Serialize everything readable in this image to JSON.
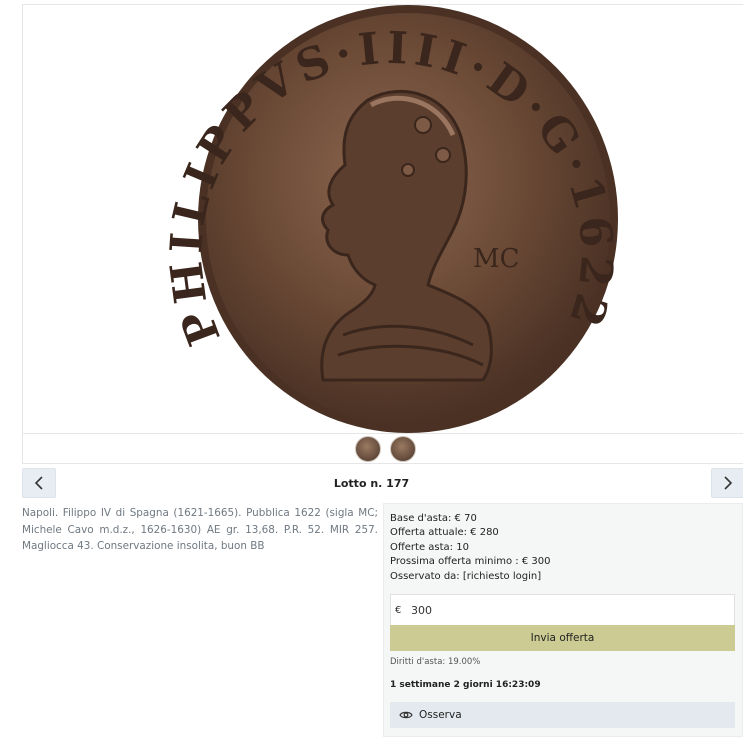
{
  "lot": {
    "title": "Lotto n. 177",
    "description": "Napoli. Filippo IV di Spagna (1621-1665). Pubblica 1622 (sigla MC; Michele Cavo m.d.z., 1626-1630) AE gr. 13,68. P.R. 52. MIR 257. Magliocca 43. Conservazione insolita, buon BB"
  },
  "coin": {
    "legend": "PHILIPPVS·IIII·D·G·1622",
    "mint_mark": "MC",
    "colors": {
      "metal": "#6b4a36",
      "rim": "#4a3124",
      "highlight": "#9a7560"
    }
  },
  "navigation": {
    "prev_icon": "chevron-left-icon",
    "next_icon": "chevron-right-icon"
  },
  "bid": {
    "base_label": "Base d'asta: € 70",
    "current_label": "Offerta attuale: € 280",
    "count_label": "Offerte asta: 10",
    "next_min_label": "Prossima offerta minimo : € 300",
    "watched_label": "Osservato da: [richiesto login]",
    "currency": "€",
    "amount": "300",
    "submit_label": "Invia offerta",
    "fees_label": "Diritti d'asta: 19.00%",
    "countdown": "1 settimane 2 giorni 16:23:09",
    "watch_label": "Osserva",
    "watch_icon": "eye-icon",
    "accent_color": "#cbcb93"
  }
}
